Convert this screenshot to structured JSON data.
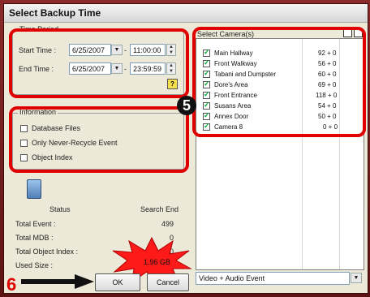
{
  "window": {
    "title": "Select Backup Time"
  },
  "time_period": {
    "legend": "Time Period",
    "start_label": "Start Time :",
    "start_date": "6/25/2007",
    "start_time": "11:00:00",
    "end_label": "End Time :",
    "end_date": "6/25/2007",
    "end_time": "23:59:59",
    "dash": "-"
  },
  "information": {
    "legend": "Information",
    "options": [
      {
        "label": "Database Files",
        "checked": false
      },
      {
        "label": "Only Never-Recycle Event",
        "checked": false
      },
      {
        "label": "Object Index",
        "checked": false
      }
    ]
  },
  "status": {
    "status_label": "Status",
    "search_label": "Search End",
    "total_event_label": "Total Event :",
    "total_event_value": "499",
    "total_mdb_label": "Total MDB :",
    "total_mdb_value": "0",
    "total_object_index_label": "Total Object Index :",
    "total_object_index_value": "0",
    "used_size_label": "Used Size :",
    "used_size_value": "1.96 GB"
  },
  "buttons": {
    "ok": "OK",
    "cancel": "Cancel"
  },
  "cameras": {
    "legend": "Select Camera(s)",
    "items": [
      {
        "name": "Main Hallway",
        "value": "92 + 0",
        "checked": true
      },
      {
        "name": "Front Walkway",
        "value": "56 + 0",
        "checked": true
      },
      {
        "name": "Tabani and Dumpster",
        "value": "60 + 0",
        "checked": true
      },
      {
        "name": "Dore's Area",
        "value": "69 + 0",
        "checked": true
      },
      {
        "name": "Front Entrance",
        "value": "118 + 0",
        "checked": true
      },
      {
        "name": "Susans Area",
        "value": "54 + 0",
        "checked": true
      },
      {
        "name": "Annex Door",
        "value": "50 + 0",
        "checked": true
      },
      {
        "name": "Camera 8",
        "value": "0 + 0",
        "checked": true
      }
    ],
    "event_filter": "Video + Audio Event"
  },
  "annotations": {
    "five": "5",
    "six": "6"
  },
  "colors": {
    "highlight": "#e00000",
    "window": "#ece9d8",
    "frame": "#7a1f1f"
  }
}
